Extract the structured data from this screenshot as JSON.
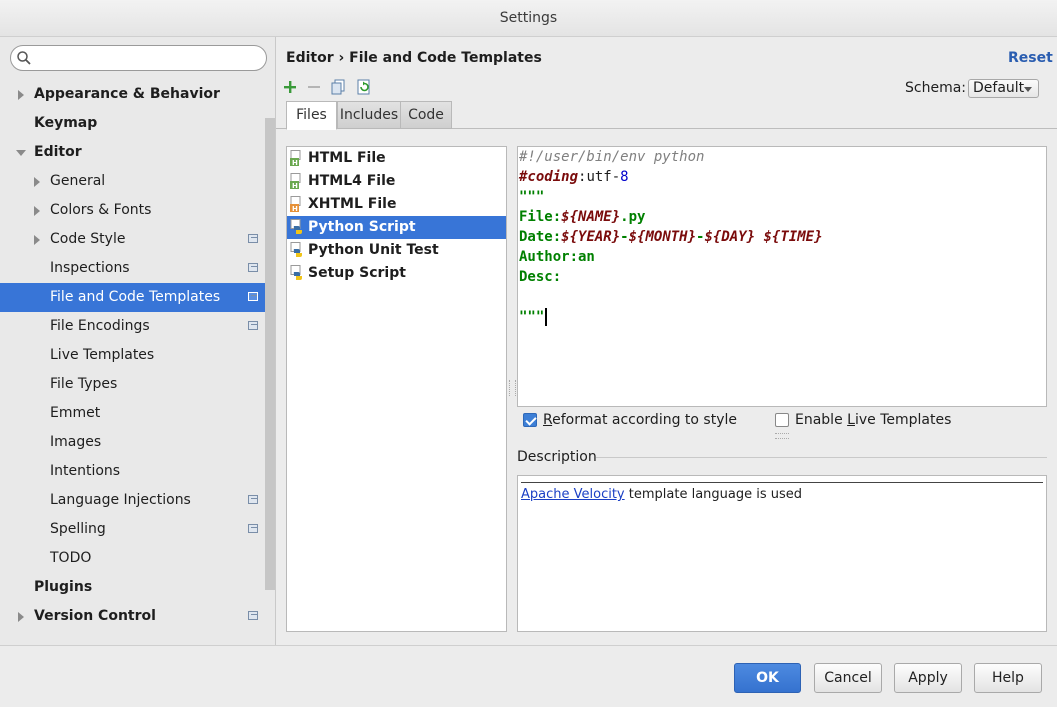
{
  "window": {
    "title": "Settings"
  },
  "search": {
    "value": "",
    "placeholder": ""
  },
  "sidebar": {
    "items": [
      {
        "label": "Appearance & Behavior"
      },
      {
        "label": "Keymap"
      },
      {
        "label": "Editor"
      },
      {
        "label": "General"
      },
      {
        "label": "Colors & Fonts"
      },
      {
        "label": "Code Style"
      },
      {
        "label": "Inspections"
      },
      {
        "label": "File and Code Templates"
      },
      {
        "label": "File Encodings"
      },
      {
        "label": "Live Templates"
      },
      {
        "label": "File Types"
      },
      {
        "label": "Emmet"
      },
      {
        "label": "Images"
      },
      {
        "label": "Intentions"
      },
      {
        "label": "Language Injections"
      },
      {
        "label": "Spelling"
      },
      {
        "label": "TODO"
      },
      {
        "label": "Plugins"
      },
      {
        "label": "Version Control"
      }
    ],
    "selected": "File and Code Templates"
  },
  "header": {
    "breadcrumb_parent": "Editor",
    "breadcrumb_separator": "›",
    "breadcrumb_current": "File and Code Templates",
    "reset_label": "Reset"
  },
  "schema": {
    "label": "Schema:",
    "value": "Default"
  },
  "toolbar": {
    "icons": [
      "add-icon",
      "remove-icon",
      "copy-icon",
      "reset-to-default-icon"
    ]
  },
  "tabs": [
    {
      "label": "Files",
      "active": true
    },
    {
      "label": "Includes",
      "active": false
    },
    {
      "label": "Code",
      "active": false
    }
  ],
  "templates": [
    {
      "label": "HTML File",
      "icon": "html-file-icon"
    },
    {
      "label": "HTML4 File",
      "icon": "html-file-icon"
    },
    {
      "label": "XHTML File",
      "icon": "xhtml-file-icon"
    },
    {
      "label": "Python Script",
      "icon": "python-file-icon",
      "selected": true
    },
    {
      "label": "Python Unit Test",
      "icon": "python-file-icon"
    },
    {
      "label": "Setup Script",
      "icon": "python-file-icon"
    }
  ],
  "editor": {
    "l1": "#!/user/bin/env python",
    "l2a": "#coding",
    "l2b": ":utf-",
    "l2c": "8",
    "l3": "\"\"\"",
    "l4a": "File:",
    "l4b": "${NAME}",
    "l4c": ".py",
    "l5a": "Date:",
    "l5b": "${YEAR}",
    "l5c": "-",
    "l5d": "${MONTH}",
    "l5e": "-",
    "l5f": "${DAY}",
    "l5g": " ",
    "l5h": "${TIME}",
    "l6": "Author:an",
    "l7": "Desc:",
    "l8": "",
    "l9": "\"\"\""
  },
  "options": {
    "reformat": {
      "label_pre": "",
      "label_mnemonic": "R",
      "label_post": "eformat according to style",
      "checked": true
    },
    "live_templates": {
      "label_pre": "Enable ",
      "label_mnemonic": "L",
      "label_post": "ive Templates",
      "checked": false
    }
  },
  "description": {
    "heading": "Description",
    "link_text": "Apache Velocity",
    "text": " template language is used"
  },
  "buttons": {
    "ok": "OK",
    "cancel": "Cancel",
    "apply": "Apply",
    "help": "Help"
  },
  "colors": {
    "accent": "#3875d7",
    "reset_link": "#2a5db0"
  }
}
